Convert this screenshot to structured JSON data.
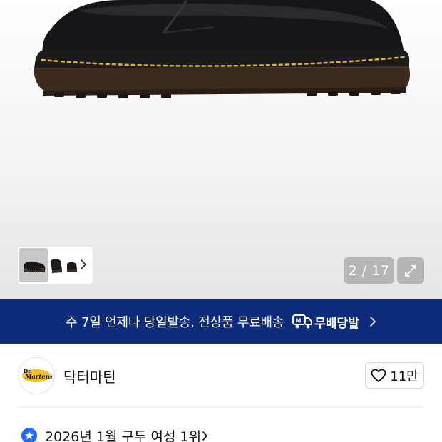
{
  "gallery": {
    "page_current": "2",
    "page_total": "17",
    "page_label": "2 / 17",
    "thumbnails": [
      "boot-front",
      "boot-pair",
      "boot-side"
    ]
  },
  "banner": {
    "text": "주 7일 언제나 당일발송, 전상품 무료배송",
    "service_name": "무배당발",
    "background": "#0d2c7c"
  },
  "brand": {
    "name": "닥터마틴",
    "logo_alt": "Dr. Martens",
    "likes": "11만"
  },
  "ranking": {
    "text": "2026년 1월 구두 여성 1위",
    "accent": "#1f6bff"
  },
  "icons": {
    "expand": "expand-icon",
    "heart": "heart-icon",
    "chevron": "chevron-right-icon",
    "truck": "truck-icon",
    "star": "star-icon"
  }
}
